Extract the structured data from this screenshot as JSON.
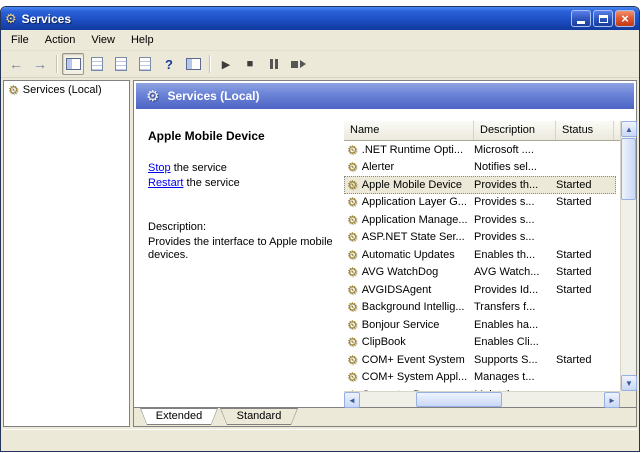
{
  "window": {
    "title": "Services"
  },
  "titlebar": {
    "close_glyph": "×"
  },
  "menu": {
    "items": [
      "File",
      "Action",
      "View",
      "Help"
    ]
  },
  "toolbar": {
    "back_glyph": "←",
    "forward_glyph": "→",
    "help_glyph": "?",
    "play_glyph": "▶",
    "stop_glyph": "■"
  },
  "tree": {
    "root_label": "Services (Local)"
  },
  "main": {
    "banner": {
      "title": "Services (Local)"
    },
    "detail": {
      "service_title": "Apple Mobile Device",
      "stop_link": "Stop",
      "stop_suffix": " the service",
      "restart_link": "Restart",
      "restart_suffix": " the service",
      "description_label": "Description:",
      "description_text": "Provides the interface to Apple mobile devices."
    },
    "table": {
      "columns": [
        "Name",
        "Description",
        "Status"
      ],
      "rows": [
        {
          "name": ".NET Runtime Opti...",
          "description": "Microsoft ....",
          "status": ""
        },
        {
          "name": "Alerter",
          "description": "Notifies sel...",
          "status": ""
        },
        {
          "name": "Apple Mobile Device",
          "description": "Provides th...",
          "status": "Started",
          "selected": true
        },
        {
          "name": "Application Layer G...",
          "description": "Provides s...",
          "status": "Started"
        },
        {
          "name": "Application Manage...",
          "description": "Provides s...",
          "status": ""
        },
        {
          "name": "ASP.NET State Ser...",
          "description": "Provides s...",
          "status": ""
        },
        {
          "name": "Automatic Updates",
          "description": "Enables th...",
          "status": "Started"
        },
        {
          "name": "AVG WatchDog",
          "description": "AVG Watch...",
          "status": "Started"
        },
        {
          "name": "AVGIDSAgent",
          "description": "Provides Id...",
          "status": "Started"
        },
        {
          "name": "Background Intellig...",
          "description": "Transfers f...",
          "status": ""
        },
        {
          "name": "Bonjour Service",
          "description": "Enables ha...",
          "status": ""
        },
        {
          "name": "ClipBook",
          "description": "Enables Cli...",
          "status": ""
        },
        {
          "name": "COM+ Event System",
          "description": "Supports S...",
          "status": "Started"
        },
        {
          "name": "COM+ System Appl...",
          "description": "Manages t...",
          "status": ""
        },
        {
          "name": "Computer Browser",
          "description": "Maintains a...",
          "status": ""
        }
      ]
    },
    "tabs": [
      {
        "label": "Extended",
        "active": true
      },
      {
        "label": "Standard",
        "active": false
      }
    ]
  },
  "icons": {
    "gear": "⚙",
    "up_arrow": "▲",
    "down_arrow": "▼",
    "left_arrow": "◄",
    "right_arrow": "►"
  },
  "colors": {
    "titlebar_blue": "#1c4cc0",
    "banner_blue": "#6a82d6",
    "chrome": "#ECE9D8",
    "selection": "#ECE9D8",
    "link": "#0000EE"
  }
}
